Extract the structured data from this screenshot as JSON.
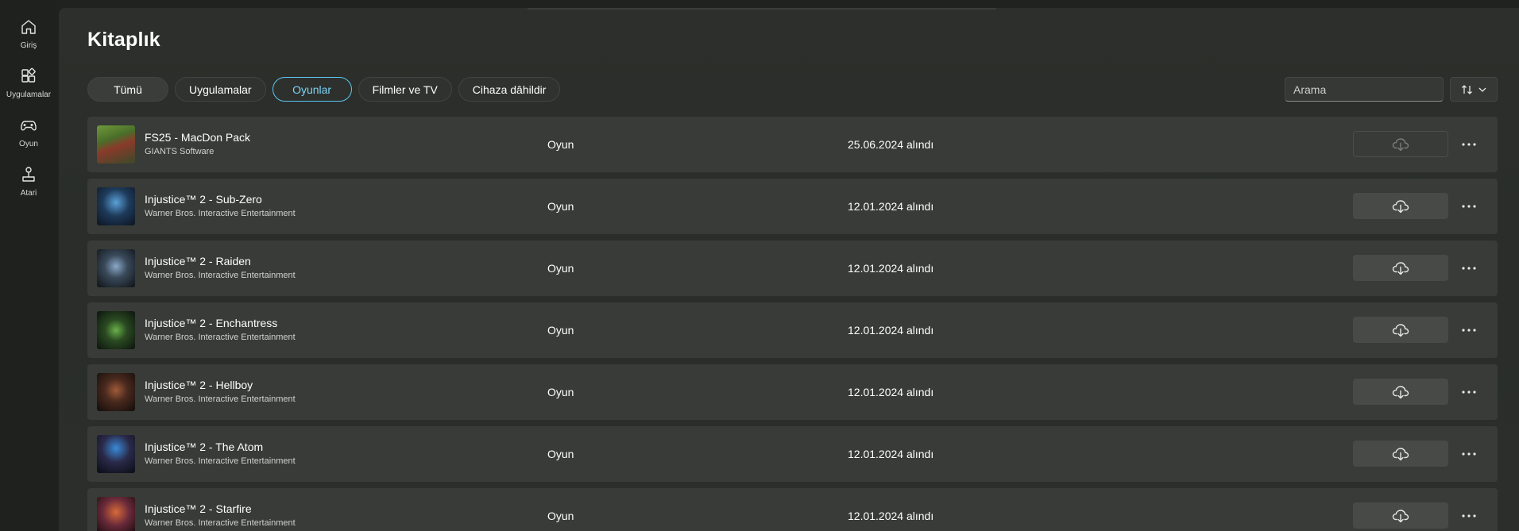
{
  "sidebar": {
    "items": [
      {
        "label": "Giriş",
        "icon": "home-icon"
      },
      {
        "label": "Uygulamalar",
        "icon": "apps-icon"
      },
      {
        "label": "Oyun",
        "icon": "gamepad-icon"
      },
      {
        "label": "Atari",
        "icon": "joystick-icon"
      }
    ]
  },
  "page": {
    "title": "Kitaplık"
  },
  "filters": {
    "chips": [
      "Tümü",
      "Uygulamalar",
      "Oyunlar",
      "Filmler ve TV",
      "Cihaza dâhildir"
    ],
    "active": "Oyunlar"
  },
  "search": {
    "placeholder": "Arama"
  },
  "colors": {
    "accent": "#5cc6f0",
    "row_bg": "#383b37",
    "panel_bg": "#2b2e2a"
  },
  "library": {
    "rows": [
      {
        "title": "FS25 - MacDon Pack",
        "publisher": "GIANTS Software",
        "type": "Oyun",
        "date": "25.06.2024 alındı",
        "download_enabled": false
      },
      {
        "title": "Injustice™ 2 - Sub-Zero",
        "publisher": "Warner Bros. Interactive Entertainment",
        "type": "Oyun",
        "date": "12.01.2024 alındı",
        "download_enabled": true
      },
      {
        "title": "Injustice™ 2 - Raiden",
        "publisher": "Warner Bros. Interactive Entertainment",
        "type": "Oyun",
        "date": "12.01.2024 alındı",
        "download_enabled": true
      },
      {
        "title": "Injustice™ 2 - Enchantress",
        "publisher": "Warner Bros. Interactive Entertainment",
        "type": "Oyun",
        "date": "12.01.2024 alındı",
        "download_enabled": true
      },
      {
        "title": "Injustice™ 2 - Hellboy",
        "publisher": "Warner Bros. Interactive Entertainment",
        "type": "Oyun",
        "date": "12.01.2024 alındı",
        "download_enabled": true
      },
      {
        "title": "Injustice™ 2 - The Atom",
        "publisher": "Warner Bros. Interactive Entertainment",
        "type": "Oyun",
        "date": "12.01.2024 alındı",
        "download_enabled": true
      },
      {
        "title": "Injustice™ 2 - Starfire",
        "publisher": "Warner Bros. Interactive Entertainment",
        "type": "Oyun",
        "date": "12.01.2024 alındı",
        "download_enabled": true
      }
    ]
  }
}
